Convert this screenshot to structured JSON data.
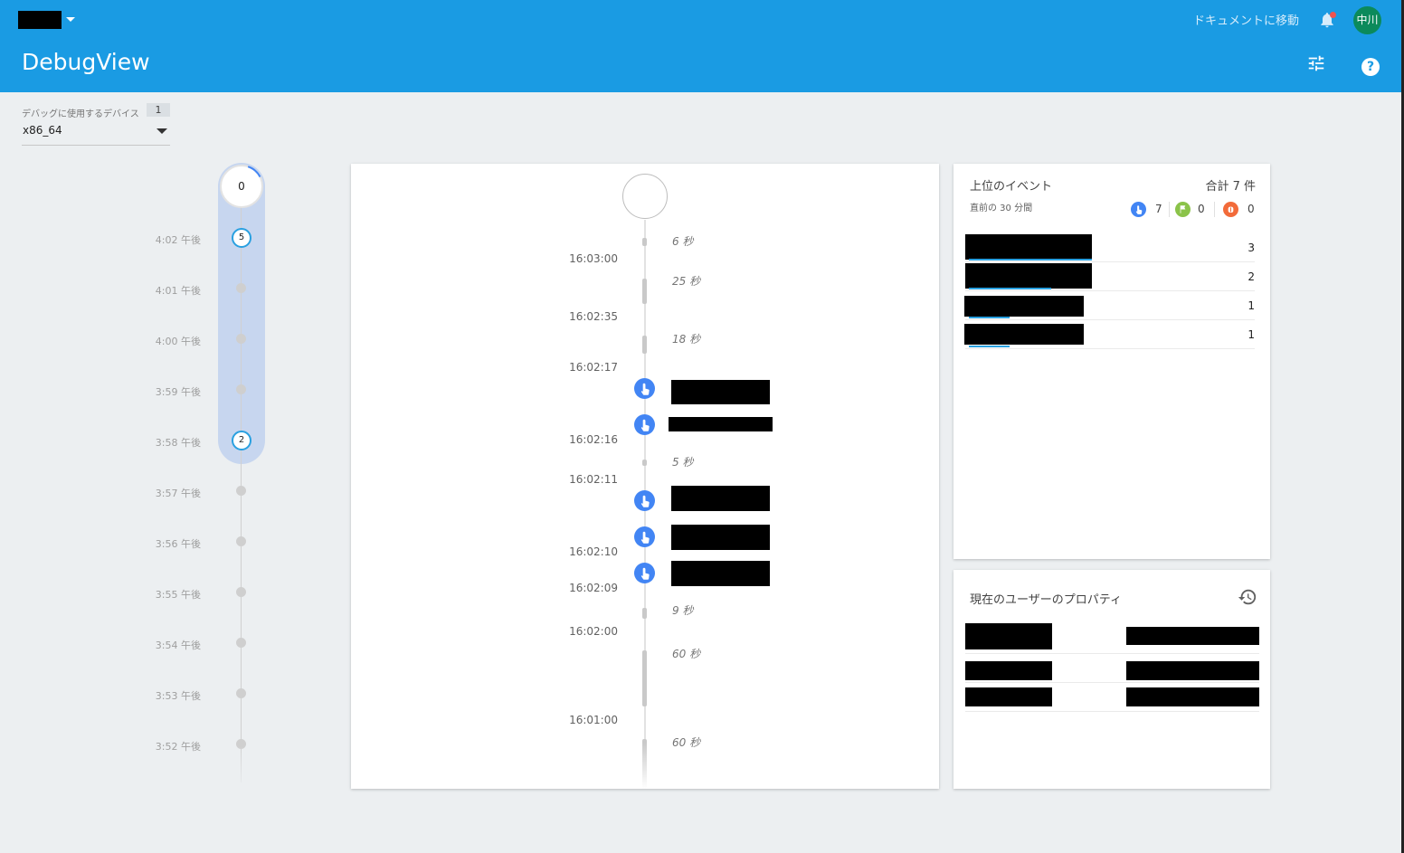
{
  "header": {
    "docs_link": "ドキュメントに移動",
    "avatar_initials": "中川",
    "title": "DebugView",
    "brand_color": "#1a9be3"
  },
  "device": {
    "label": "デバッグに使用するデバイス",
    "count": "1",
    "selected": "x86_64"
  },
  "minutes": {
    "current_count": "0",
    "rows": [
      {
        "time": "4:02 午後",
        "count": "5"
      },
      {
        "time": "4:01 午後",
        "count": ""
      },
      {
        "time": "4:00 午後",
        "count": ""
      },
      {
        "time": "3:59 午後",
        "count": ""
      },
      {
        "time": "3:58 午後",
        "count": "2"
      },
      {
        "time": "3:57 午後",
        "count": ""
      },
      {
        "time": "3:56 午後",
        "count": ""
      },
      {
        "time": "3:55 午後",
        "count": ""
      },
      {
        "time": "3:54 午後",
        "count": ""
      },
      {
        "time": "3:53 午後",
        "count": ""
      },
      {
        "time": "3:52 午後",
        "count": ""
      }
    ]
  },
  "stream": {
    "timestamps": [
      "16:03:00",
      "16:02:35",
      "16:02:17",
      "16:02:16",
      "16:02:11",
      "16:02:10",
      "16:02:09",
      "16:02:00",
      "16:01:00"
    ],
    "durations": [
      "6 秒",
      "25 秒",
      "18 秒",
      "5 秒",
      "9 秒",
      "60 秒",
      "60 秒"
    ],
    "event_icon": "touch-event-icon"
  },
  "top_events": {
    "title": "上位のイベント",
    "total": "合計 7 件",
    "subtitle": "直前の 30 分間",
    "counts": {
      "events": "7",
      "conversions": "0",
      "errors": "0"
    },
    "rows": [
      {
        "count": "3",
        "fraction": 1.0
      },
      {
        "count": "2",
        "fraction": 0.67
      },
      {
        "count": "1",
        "fraction": 0.33
      },
      {
        "count": "1",
        "fraction": 0.33
      }
    ]
  },
  "user_properties": {
    "title": "現在のユーザーのプロパティ"
  }
}
